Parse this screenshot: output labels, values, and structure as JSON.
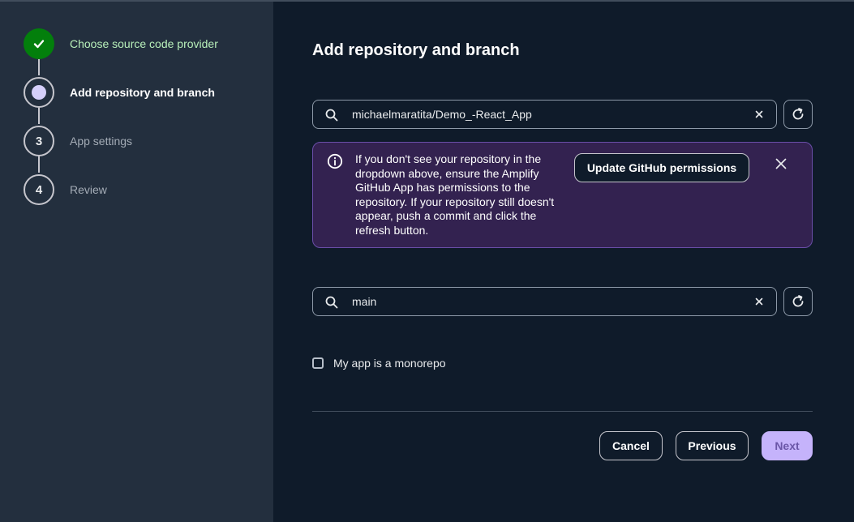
{
  "steps": [
    {
      "number": "1",
      "label": "Choose source code provider",
      "state": "done"
    },
    {
      "number": "2",
      "label": "Add repository and branch",
      "state": "current"
    },
    {
      "number": "3",
      "label": "App settings",
      "state": "pending"
    },
    {
      "number": "4",
      "label": "Review",
      "state": "pending"
    }
  ],
  "page": {
    "title": "Add repository and branch"
  },
  "repository": {
    "value": "michaelmaratita/Demo_-React_App"
  },
  "alert": {
    "message": "If you don't see your repository in the dropdown above, ensure the Amplify GitHub App has permissions to the repository. If your repository still doesn't appear, push a commit and click the refresh button.",
    "action_label": "Update GitHub permissions"
  },
  "branch": {
    "value": "main"
  },
  "monorepo": {
    "label": "My app is a monorepo",
    "checked": false
  },
  "footer": {
    "cancel": "Cancel",
    "previous": "Previous",
    "next": "Next"
  },
  "colors": {
    "done": "#037f0c",
    "alert_bg": "#332250",
    "primary": "#c5b3fb",
    "sidebar": "#232f3e",
    "background": "#0f1b2a"
  },
  "icons": {
    "search": "search-icon",
    "clear": "clear-icon",
    "refresh": "refresh-icon",
    "info": "info-icon",
    "close": "close-icon",
    "check": "check-icon"
  }
}
